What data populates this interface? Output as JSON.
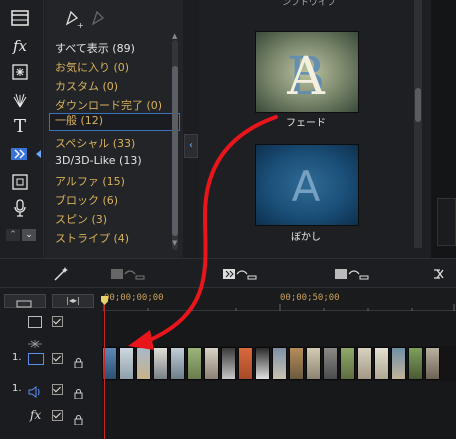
{
  "category_panel": {
    "items": [
      {
        "label": "すべて表示 (89)",
        "style": "white"
      },
      {
        "label": "お気に入り (0)",
        "style": "gold"
      },
      {
        "label": "カスタム (0)",
        "style": "gold"
      },
      {
        "label": "ダウンロード完了 (0)",
        "style": "gold"
      },
      {
        "label": "一般 (12)",
        "style": "gold",
        "selected": true
      },
      {
        "label": "スペシャル (33)",
        "style": "gold"
      },
      {
        "label": "3D/3D-Like (13)",
        "style": "white"
      },
      {
        "label": "アルファ (15)",
        "style": "gold"
      },
      {
        "label": "ブロック (6)",
        "style": "gold"
      },
      {
        "label": "スピン (3)",
        "style": "gold"
      },
      {
        "label": "ストライプ (4)",
        "style": "gold"
      }
    ]
  },
  "library": {
    "top_caption": "ンフトワイフ",
    "items": [
      {
        "label": "フェード",
        "glyph": "A"
      },
      {
        "label": "ぼかし",
        "glyph": "A"
      }
    ]
  },
  "timeline": {
    "timecodes": [
      "00;00;00;00",
      "00;00;50;00"
    ],
    "track_labels": [
      "1.",
      "1.",
      "fx"
    ]
  },
  "colors": {
    "accent_blue": "#3a73b8",
    "playhead": "#c4262a",
    "annotation_arrow": "#e8151b",
    "category_gold": "#d8b25c"
  },
  "icons": [
    "scene-icon",
    "fx-icon",
    "particle-icon",
    "fireworks-icon",
    "title-icon",
    "transition-icon",
    "pip-icon",
    "mic-icon"
  ]
}
